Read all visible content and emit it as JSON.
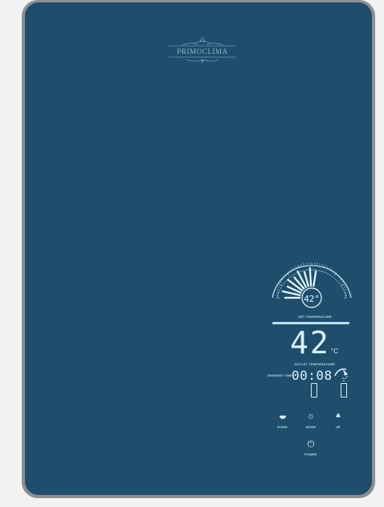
{
  "brand": {
    "name": "PRIMOCLIMA"
  },
  "display": {
    "gauge_value": "42°",
    "set_temperature_label": "SET TEMPERATURE",
    "outlet_temperature": "42",
    "temperature_unit": "°C",
    "outlet_temperature_label": "OUTLET TEMPERATURE",
    "shower_time_label": "SHOWER TIME",
    "shower_time": "00:08"
  },
  "controls": {
    "down_label": "DOWN",
    "mode_label": "MODE",
    "up_label": "UP",
    "power_label": "POWER"
  },
  "colors": {
    "panel": "#1f4e6d",
    "frame": "#8c8f92",
    "display": "#d8f2fb"
  }
}
